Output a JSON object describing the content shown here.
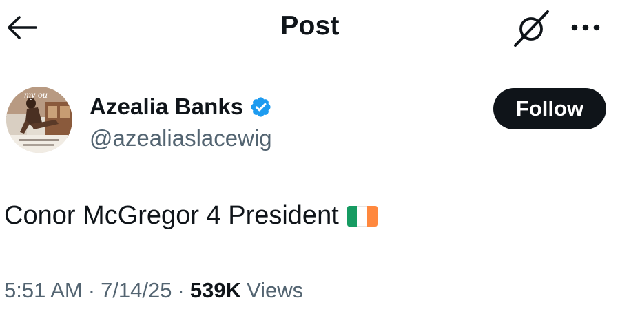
{
  "header": {
    "title": "Post",
    "back_icon": "arrow-left-icon",
    "grok_icon": "grok-icon",
    "more_icon": "more-horizontal-icon"
  },
  "author": {
    "display_name": "Azealia Banks",
    "handle": "@azealiaslacewig",
    "verified": true,
    "verified_color": "#1d9bf0",
    "avatar_mark": "my ou",
    "follow_label": "Follow"
  },
  "post": {
    "text": "Conor McGregor 4 President",
    "emoji": "flag-ireland-icon",
    "flag_colors": [
      "#169b62",
      "#ffffff",
      "#ff883e"
    ]
  },
  "meta": {
    "time": "5:51 AM",
    "separator": "·",
    "date": "7/14/25",
    "views_count": "539K",
    "views_label": "Views"
  },
  "colors": {
    "text_primary": "#0f1419",
    "text_secondary": "#536471",
    "follow_bg": "#0f1419",
    "background": "#ffffff"
  }
}
